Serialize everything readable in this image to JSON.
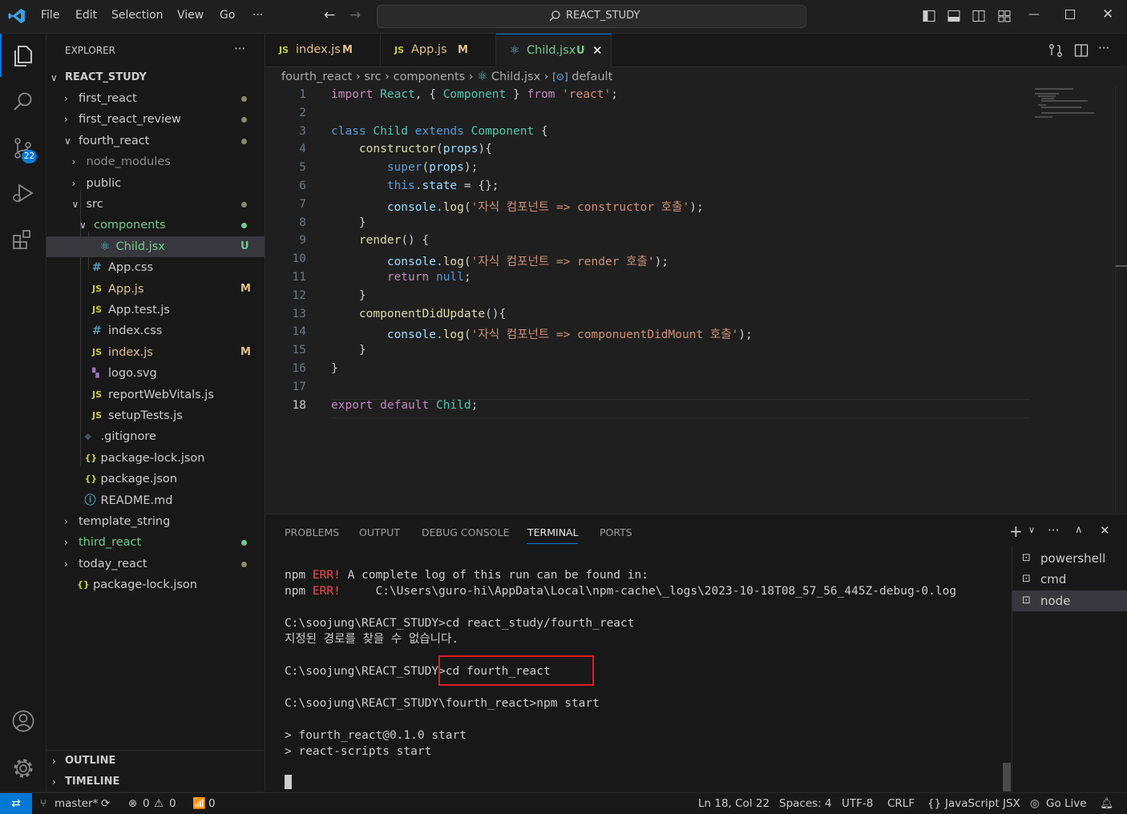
{
  "titlebar": {
    "menu": [
      "File",
      "Edit",
      "Selection",
      "View",
      "Go",
      "···"
    ],
    "search_text": "REACT_STUDY"
  },
  "activity": {
    "scm_badge": "22"
  },
  "sidebar": {
    "header": "EXPLORER",
    "root": "REACT_STUDY",
    "items": [
      {
        "label": "first_react",
        "color": "#cccccc",
        "status": "dot"
      },
      {
        "label": "first_react_review",
        "color": "#cccccc",
        "status": "dot"
      },
      {
        "label": "fourth_react",
        "color": "#cccccc",
        "status": "dot"
      },
      {
        "label": "node_modules",
        "color": "#8c8c8c",
        "status": ""
      },
      {
        "label": "public",
        "color": "#cccccc",
        "status": ""
      },
      {
        "label": "src",
        "color": "#cccccc",
        "status": "dot"
      },
      {
        "label": "components",
        "color": "#73c991",
        "status": "dot"
      },
      {
        "label": "Child.jsx",
        "color": "#73c991",
        "status": "U"
      },
      {
        "label": "App.css",
        "color": "#cccccc",
        "status": ""
      },
      {
        "label": "App.js",
        "color": "#e2c08d",
        "status": "M"
      },
      {
        "label": "App.test.js",
        "color": "#cccccc",
        "status": ""
      },
      {
        "label": "index.css",
        "color": "#cccccc",
        "status": ""
      },
      {
        "label": "index.js",
        "color": "#e2c08d",
        "status": "M"
      },
      {
        "label": "logo.svg",
        "color": "#cccccc",
        "status": ""
      },
      {
        "label": "reportWebVitals.js",
        "color": "#cccccc",
        "status": ""
      },
      {
        "label": "setupTests.js",
        "color": "#cccccc",
        "status": ""
      },
      {
        "label": ".gitignore",
        "color": "#cccccc",
        "status": ""
      },
      {
        "label": "package-lock.json",
        "color": "#cccccc",
        "status": ""
      },
      {
        "label": "package.json",
        "color": "#cccccc",
        "status": ""
      },
      {
        "label": "README.md",
        "color": "#cccccc",
        "status": ""
      },
      {
        "label": "template_string",
        "color": "#cccccc",
        "status": ""
      },
      {
        "label": "third_react",
        "color": "#73c991",
        "status": "dot"
      },
      {
        "label": "today_react",
        "color": "#cccccc",
        "status": "dot"
      },
      {
        "label": "package-lock.json",
        "color": "#cccccc",
        "status": ""
      }
    ],
    "outline": "OUTLINE",
    "timeline": "TIMELINE"
  },
  "tabs": [
    {
      "label": "index.js",
      "status": "M",
      "icon": "JS"
    },
    {
      "label": "App.js",
      "status": "M",
      "icon": "JS"
    },
    {
      "label": "Child.jsx",
      "status": "U",
      "icon": "react-icon"
    }
  ],
  "breadcrumb": [
    "fourth_react",
    "src",
    "components",
    "Child.jsx",
    "default"
  ],
  "editor": {
    "line_numbers": [
      "1",
      "2",
      "3",
      "4",
      "5",
      "6",
      "7",
      "8",
      "9",
      "10",
      "11",
      "12",
      "13",
      "14",
      "15",
      "16",
      "17",
      "18"
    ],
    "lines": [
      "import React, { Component } from 'react';",
      "",
      "class Child extends Component {",
      "    constructor(props){",
      "        super(props);",
      "        this.state = {};",
      "        console.log('자식 컴포넌트 => constructor 호출');",
      "    }",
      "    render() {",
      "        console.log('자식 컴포넌트 => render 호출');",
      "        return null;",
      "    }",
      "    componentDidUpdate(){",
      "        console.log('자식 컴포넌트 => componuentDidMount 호출');",
      "    }",
      "}",
      "",
      "export default Child;"
    ]
  },
  "panel": {
    "tabs": [
      "PROBLEMS",
      "OUTPUT",
      "DEBUG CONSOLE",
      "TERMINAL",
      "PORTS"
    ],
    "active_tab": "TERMINAL",
    "terminal_lines": [
      "npm ERR! A complete log of this run can be found in:",
      "npm ERR!     C:\\Users\\guro-hi\\AppData\\Local\\npm-cache\\_logs\\2023-10-18T08_57_56_445Z-debug-0.log",
      "",
      "C:\\soojung\\REACT_STUDY>cd react_study/fourth_react",
      "지정된 경로를 찾을 수 없습니다.",
      "",
      "C:\\soojung\\REACT_STUDY>cd fourth_react",
      "",
      "C:\\soojung\\REACT_STUDY\\fourth_react>npm start",
      "",
      "> fourth_react@0.1.0 start",
      "> react-scripts start"
    ],
    "terminals": [
      "powershell",
      "cmd",
      "node"
    ]
  },
  "statusbar": {
    "branch": "master*",
    "errors": "0",
    "warnings": "0",
    "ports": "0",
    "position": "Ln 18, Col 22",
    "spaces": "Spaces: 4",
    "encoding": "UTF-8",
    "eol": "CRLF",
    "language": "JavaScript JSX",
    "golive": "Go Live"
  }
}
